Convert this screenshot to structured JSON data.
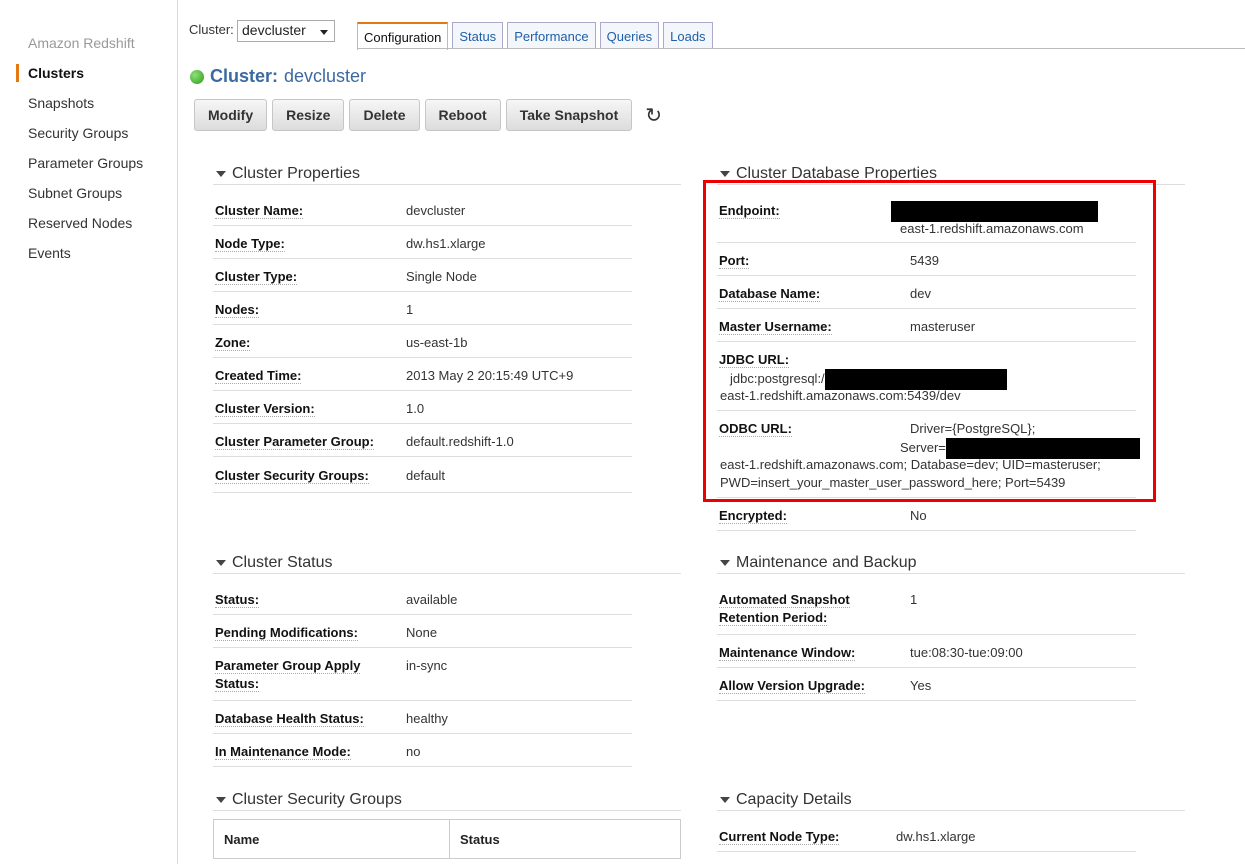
{
  "sidebar": {
    "brand": "Amazon Redshift",
    "items": [
      {
        "label": "Clusters",
        "active": true
      },
      {
        "label": "Snapshots",
        "active": false
      },
      {
        "label": "Security Groups",
        "active": false
      },
      {
        "label": "Parameter Groups",
        "active": false
      },
      {
        "label": "Subnet Groups",
        "active": false
      },
      {
        "label": "Reserved Nodes",
        "active": false
      },
      {
        "label": "Events",
        "active": false
      }
    ]
  },
  "topbar": {
    "cluster_label": "Cluster:",
    "cluster_value": "devcluster",
    "tabs": [
      "Configuration",
      "Status",
      "Performance",
      "Queries",
      "Loads"
    ],
    "active_tab": "Configuration"
  },
  "title": {
    "prefix": "Cluster:",
    "name": "devcluster",
    "status_color": "#2a9a16"
  },
  "actions": [
    "Modify",
    "Resize",
    "Delete",
    "Reboot",
    "Take Snapshot"
  ],
  "cluster_properties": {
    "heading": "Cluster Properties",
    "rows": [
      {
        "k": "Cluster Name:",
        "v": "devcluster"
      },
      {
        "k": "Node Type:",
        "v": "dw.hs1.xlarge"
      },
      {
        "k": "Cluster Type:",
        "v": "Single Node"
      },
      {
        "k": "Nodes:",
        "v": "1"
      },
      {
        "k": "Zone:",
        "v": "us-east-1b"
      },
      {
        "k": "Created Time:",
        "v": "2013 May 2 20:15:49 UTC+9"
      },
      {
        "k": "Cluster Version:",
        "v": "1.0"
      },
      {
        "k": "Cluster Parameter Group:",
        "v": "default.redshift-1.0"
      },
      {
        "k": "Cluster Security Groups:",
        "v": "default"
      }
    ]
  },
  "db_properties": {
    "heading": "Cluster Database Properties",
    "endpoint_label": "Endpoint:",
    "endpoint_tail": "east-1.redshift.amazonaws.com",
    "port_label": "Port:",
    "port": "5439",
    "dbname_label": "Database Name:",
    "dbname": "dev",
    "master_label": "Master Username:",
    "master": "masteruser",
    "jdbc_label": "JDBC URL:",
    "jdbc_prefix": "jdbc:postgresql:/",
    "jdbc_tail": "east-1.redshift.amazonaws.com:5439/dev",
    "odbc_label": "ODBC URL:",
    "odbc_driver": "Driver={PostgreSQL};",
    "odbc_server": "Server=",
    "odbc_line3": "east-1.redshift.amazonaws.com; Database=dev; UID=masteruser;",
    "odbc_line4": "PWD=insert_your_master_user_password_here; Port=5439",
    "encrypted_label": "Encrypted:",
    "encrypted": "No"
  },
  "cluster_status": {
    "heading": "Cluster Status",
    "rows": [
      {
        "k": "Status:",
        "v": "available"
      },
      {
        "k": "Pending Modifications:",
        "v": "None"
      },
      {
        "k": "Parameter Group Apply Status:",
        "v": "in-sync"
      },
      {
        "k": "Database Health Status:",
        "v": "healthy"
      },
      {
        "k": "In Maintenance Mode:",
        "v": "no"
      }
    ]
  },
  "maintenance": {
    "heading": "Maintenance and Backup",
    "rows": [
      {
        "k": "Automated Snapshot Retention Period:",
        "v": "1"
      },
      {
        "k": "Maintenance Window:",
        "v": "tue:08:30-tue:09:00"
      },
      {
        "k": "Allow Version Upgrade:",
        "v": "Yes"
      }
    ]
  },
  "security_groups": {
    "heading": "Cluster Security Groups",
    "columns": [
      "Name",
      "Status"
    ]
  },
  "capacity": {
    "heading": "Capacity Details",
    "rows": [
      {
        "k": "Current Node Type:",
        "v": "dw.hs1.xlarge"
      }
    ]
  }
}
